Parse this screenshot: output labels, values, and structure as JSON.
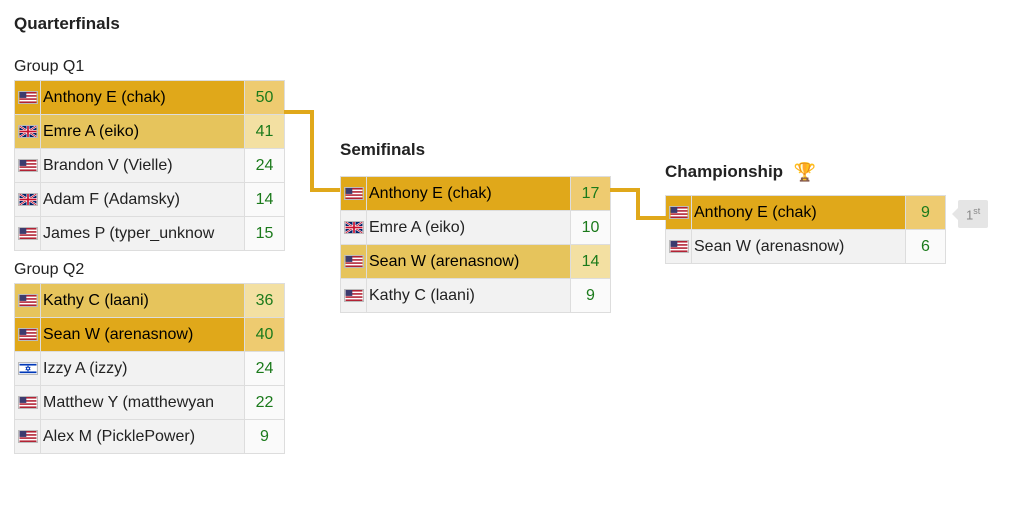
{
  "quarterfinals": {
    "title": "Quarterfinals",
    "groups": [
      {
        "label": "Group Q1",
        "rows": [
          {
            "flag": "us",
            "name": "Anthony E (chak)",
            "score": 50,
            "hl": "gold"
          },
          {
            "flag": "gb",
            "name": "Emre A (eiko)",
            "score": 41,
            "hl": "gold2"
          },
          {
            "flag": "us",
            "name": "Brandon V (Vielle)",
            "score": 24,
            "hl": "none"
          },
          {
            "flag": "gb",
            "name": "Adam F (Adamsky)",
            "score": 14,
            "hl": "none"
          },
          {
            "flag": "us",
            "name": "James P (typer_unknow",
            "score": 15,
            "hl": "none"
          }
        ]
      },
      {
        "label": "Group Q2",
        "rows": [
          {
            "flag": "us",
            "name": "Kathy C (laani)",
            "score": 36,
            "hl": "gold2"
          },
          {
            "flag": "us",
            "name": "Sean W (arenasnow)",
            "score": 40,
            "hl": "gold"
          },
          {
            "flag": "il",
            "name": "Izzy A (izzy)",
            "score": 24,
            "hl": "none"
          },
          {
            "flag": "us",
            "name": "Matthew Y (matthewyan",
            "score": 22,
            "hl": "none"
          },
          {
            "flag": "us",
            "name": "Alex M (PicklePower)",
            "score": 9,
            "hl": "none"
          }
        ]
      }
    ]
  },
  "semifinals": {
    "title": "Semifinals",
    "rows": [
      {
        "flag": "us",
        "name": "Anthony E (chak)",
        "score": 17,
        "hl": "gold"
      },
      {
        "flag": "gb",
        "name": "Emre A (eiko)",
        "score": 10,
        "hl": "none"
      },
      {
        "flag": "us",
        "name": "Sean W (arenasnow)",
        "score": 14,
        "hl": "gold2"
      },
      {
        "flag": "us",
        "name": "Kathy C (laani)",
        "score": 9,
        "hl": "none"
      }
    ]
  },
  "championship": {
    "title": "Championship",
    "rows": [
      {
        "flag": "us",
        "name": "Anthony E (chak)",
        "score": 9,
        "hl": "gold"
      },
      {
        "flag": "us",
        "name": "Sean W (arenasnow)",
        "score": 6,
        "hl": "none"
      }
    ],
    "placement": "1",
    "placement_suffix": "st"
  }
}
